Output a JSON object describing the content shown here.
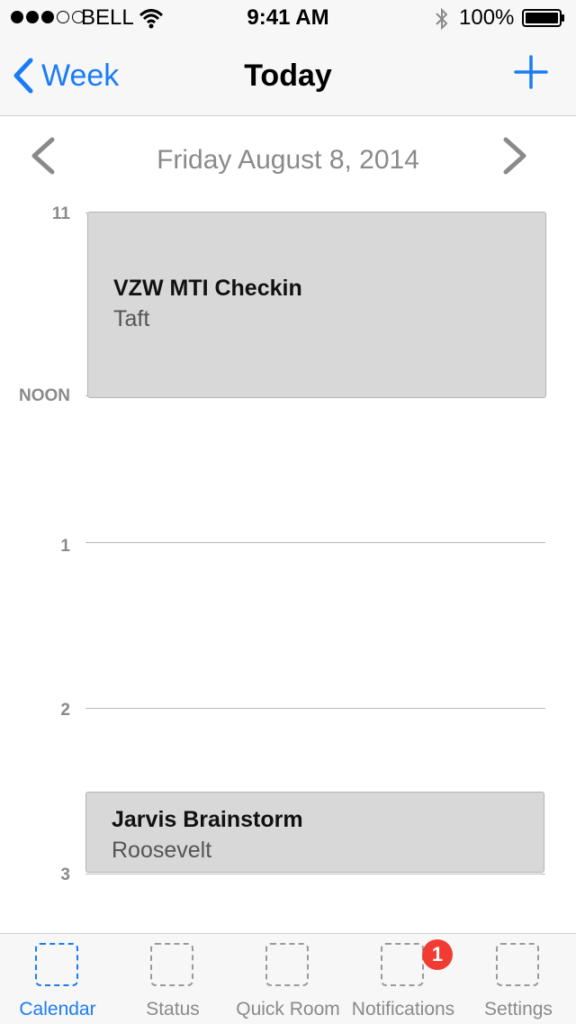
{
  "status_bar": {
    "carrier": "BELL",
    "signal_full": 3,
    "signal_total": 5,
    "time": "9:41 AM",
    "battery_percent": "100%",
    "icons": [
      "wifi-icon",
      "bluetooth-icon",
      "battery-icon"
    ]
  },
  "nav": {
    "back_label": "Week",
    "title": "Today",
    "add_icon": "plus-icon"
  },
  "date_header": {
    "label": "Friday August 8, 2014",
    "prev_icon": "chevron-left-icon",
    "next_icon": "chevron-right-icon"
  },
  "timeline": {
    "hours": [
      "11",
      "NOON",
      "1",
      "2",
      "3"
    ]
  },
  "events": [
    {
      "title": "VZW MTI Checkin",
      "room": "Taft"
    },
    {
      "title": "Jarvis Brainstorm",
      "room": "Roosevelt"
    }
  ],
  "tabs": [
    {
      "label": "Calendar",
      "active": true
    },
    {
      "label": "Status",
      "active": false
    },
    {
      "label": "Quick Room",
      "active": false
    },
    {
      "label": "Notifications",
      "active": false,
      "badge": "1"
    },
    {
      "label": "Settings",
      "active": false
    }
  ],
  "colors": {
    "accent": "#1a7cf5",
    "event_bg": "#d8d8d8",
    "badge": "#f23c33",
    "muted_text": "#8a8a8a"
  }
}
